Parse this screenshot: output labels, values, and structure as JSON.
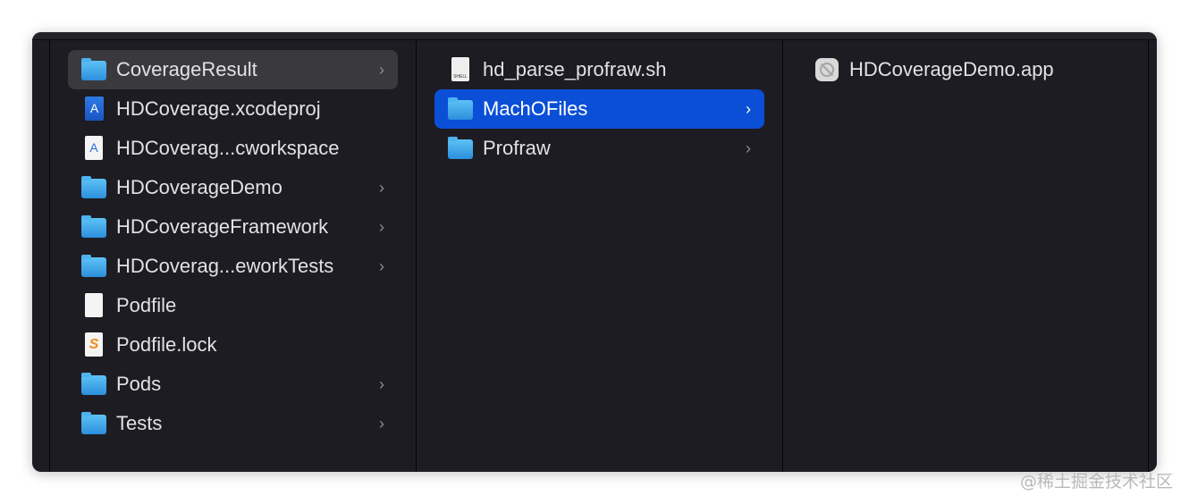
{
  "columns": [
    {
      "items": [
        {
          "label": "CoverageResult",
          "icon": "folder-icon",
          "has_children": true,
          "state": "highlighted"
        },
        {
          "label": "HDCoverage.xcodeproj",
          "icon": "xcodeproj-icon",
          "has_children": false
        },
        {
          "label": "HDCoverag...cworkspace",
          "icon": "xcworkspace-icon",
          "has_children": false
        },
        {
          "label": "HDCoverageDemo",
          "icon": "folder-icon",
          "has_children": true
        },
        {
          "label": "HDCoverageFramework",
          "icon": "folder-icon",
          "has_children": true
        },
        {
          "label": "HDCoverag...eworkTests",
          "icon": "folder-icon",
          "has_children": true
        },
        {
          "label": "Podfile",
          "icon": "document-icon",
          "has_children": false
        },
        {
          "label": "Podfile.lock",
          "icon": "sublime-document-icon",
          "has_children": false
        },
        {
          "label": "Pods",
          "icon": "folder-icon",
          "has_children": true
        },
        {
          "label": "Tests",
          "icon": "folder-icon",
          "has_children": true
        }
      ]
    },
    {
      "items": [
        {
          "label": "hd_parse_profraw.sh",
          "icon": "shell-script-icon",
          "has_children": false
        },
        {
          "label": "MachOFiles",
          "icon": "folder-icon",
          "has_children": true,
          "state": "selected"
        },
        {
          "label": "Profraw",
          "icon": "folder-icon",
          "has_children": true
        }
      ]
    },
    {
      "items": [
        {
          "label": "HDCoverageDemo.app",
          "icon": "app-disabled-icon",
          "has_children": false
        }
      ]
    }
  ],
  "icon_glyphs": {
    "xcode": "A",
    "lock": "S",
    "shell": "SHELL",
    "chevron": "›"
  },
  "watermark": "@稀土掘金技术社区",
  "colors": {
    "selection": "#0a4fd6",
    "highlight": "#3a393e",
    "background": "#1d1c22"
  }
}
